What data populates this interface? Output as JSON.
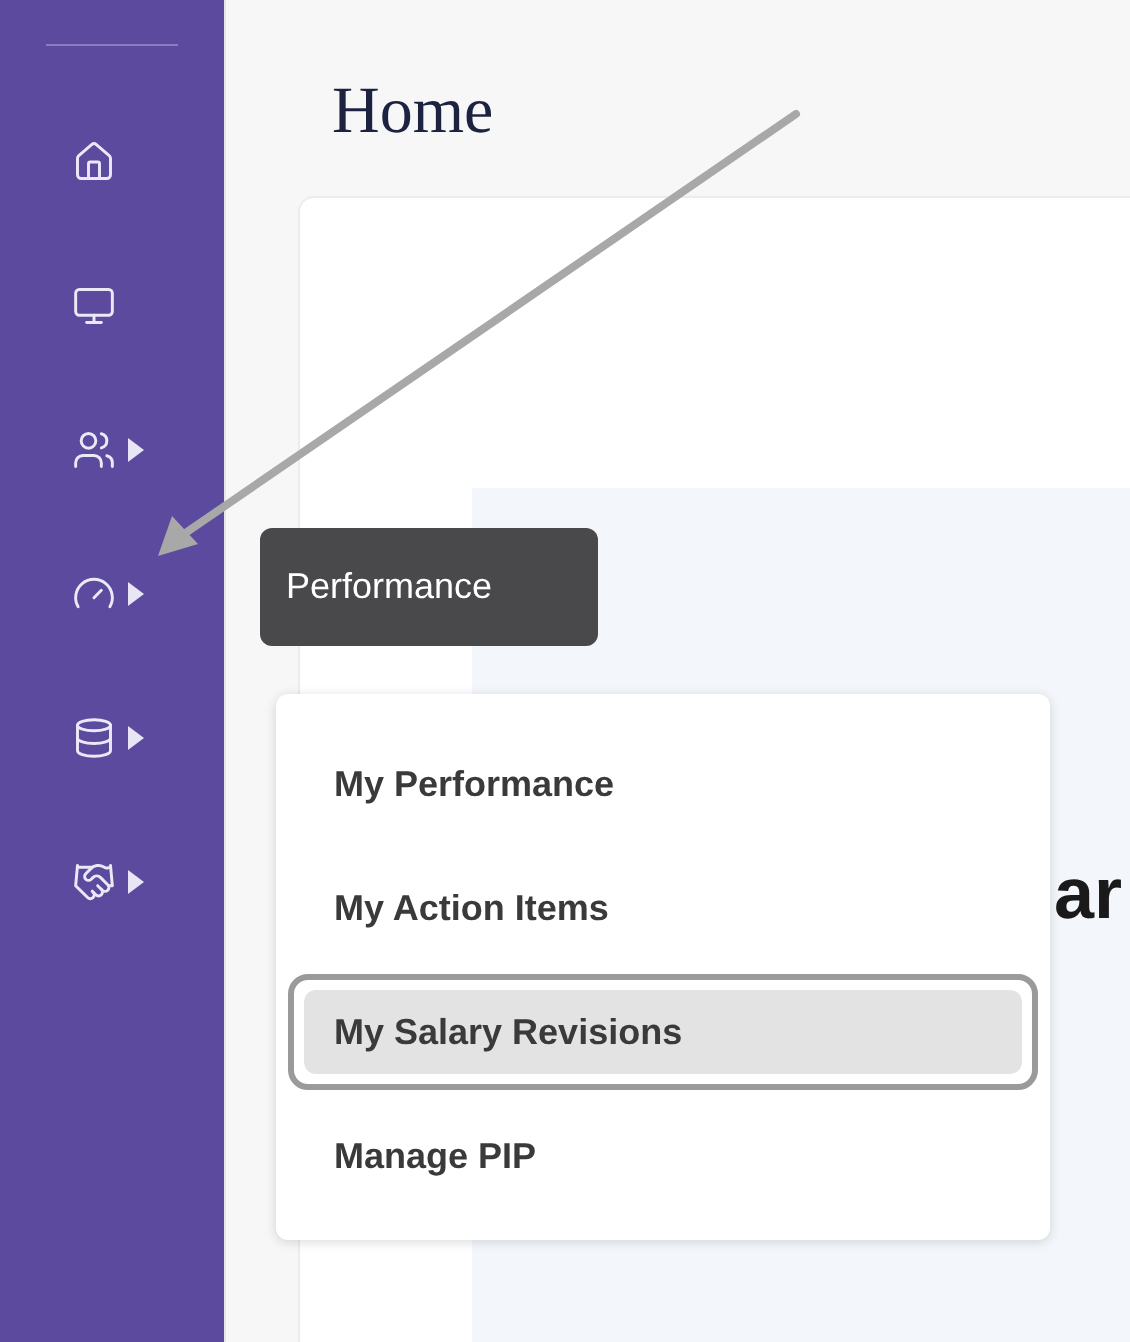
{
  "sidebar": {
    "items": [
      {
        "submenu": false
      },
      {
        "submenu": false
      },
      {
        "submenu": true
      },
      {
        "submenu": true
      },
      {
        "submenu": true
      },
      {
        "submenu": true
      }
    ]
  },
  "page": {
    "title": "Home",
    "heading": "ar"
  },
  "tooltip": {
    "text": "Performance"
  },
  "menu": {
    "items": [
      {
        "label": "My Performance",
        "selected": false
      },
      {
        "label": "My Action Items",
        "selected": false
      },
      {
        "label": "My Salary Revisions",
        "selected": true
      },
      {
        "label": "Manage PIP",
        "selected": false
      }
    ]
  }
}
